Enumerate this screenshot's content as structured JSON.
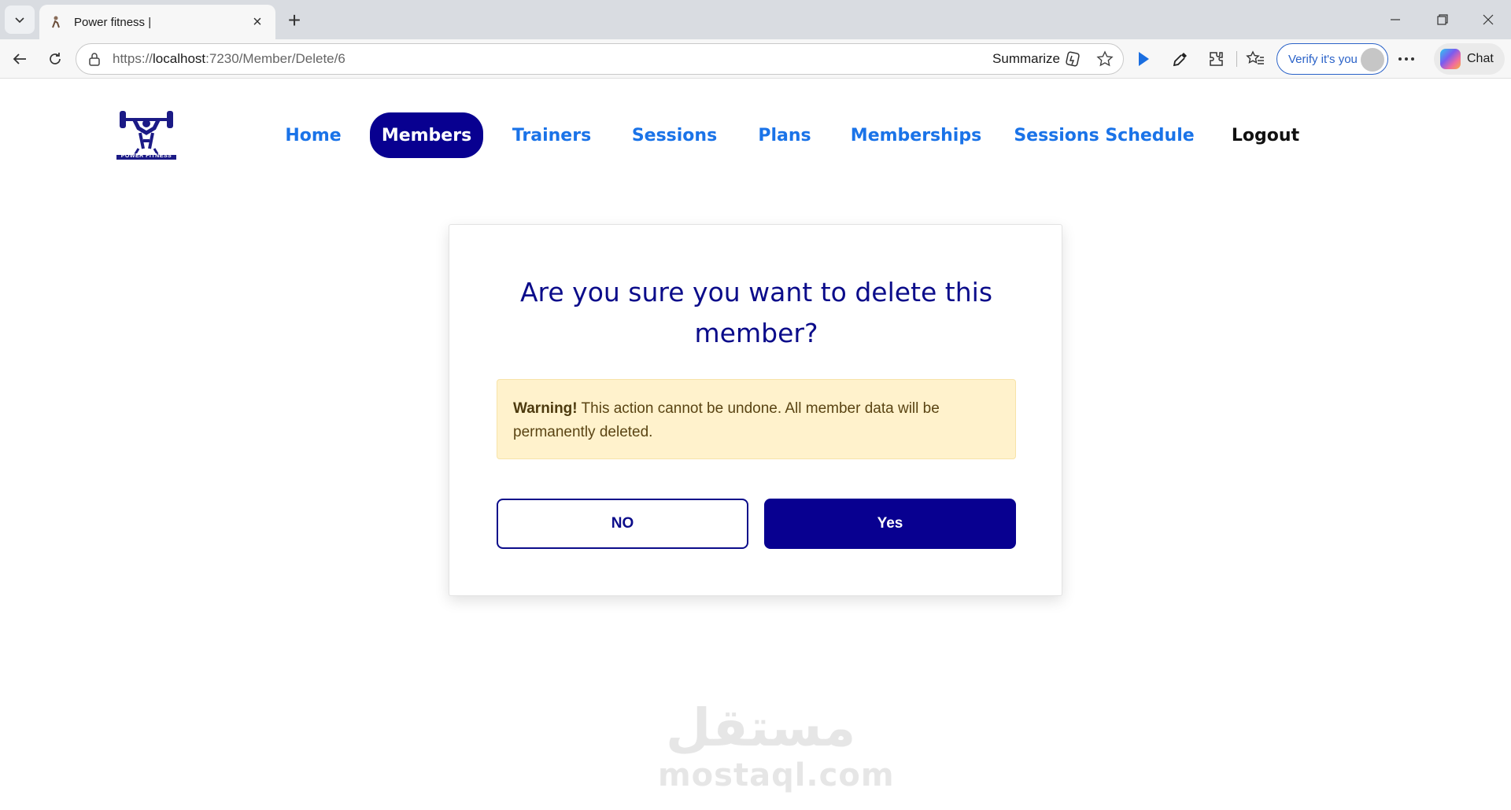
{
  "browser": {
    "tab_title": "Power fitness |",
    "url_prefix": "https://",
    "url_host": "localhost",
    "url_path": ":7230/Member/Delete/6",
    "summarize_label": "Summarize",
    "verify_label": "Verify it's you",
    "chat_label": "Chat"
  },
  "nav": {
    "logo_text": "POWER FITNESS",
    "items": [
      {
        "label": "Home"
      },
      {
        "label": "Members",
        "active": true
      },
      {
        "label": "Trainers"
      },
      {
        "label": "Sessions"
      },
      {
        "label": "Plans"
      },
      {
        "label": "Memberships"
      },
      {
        "label": "Sessions Schedule"
      },
      {
        "label": "Logout"
      }
    ]
  },
  "dialog": {
    "title": "Are you sure you want to delete this member?",
    "warning_strong": "Warning!",
    "warning_text": " This action cannot be undone. All member data will be permanently deleted.",
    "no_label": "NO",
    "yes_label": "Yes"
  },
  "watermark": {
    "arabic": "مستقل",
    "latin": "mostaql.com"
  },
  "colors": {
    "primary": "#080090",
    "link": "#1a73e8",
    "title": "#0b0c8a",
    "warning_bg": "#fff2cc",
    "warning_text": "#5a4413"
  }
}
